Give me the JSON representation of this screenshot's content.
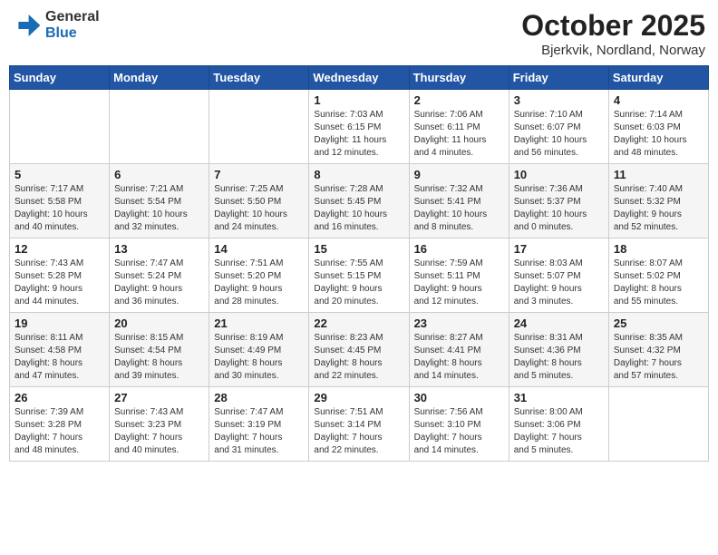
{
  "header": {
    "logo_line1": "General",
    "logo_line2": "Blue",
    "month": "October 2025",
    "location": "Bjerkvik, Nordland, Norway"
  },
  "weekdays": [
    "Sunday",
    "Monday",
    "Tuesday",
    "Wednesday",
    "Thursday",
    "Friday",
    "Saturday"
  ],
  "weeks": [
    [
      {
        "day": "",
        "info": ""
      },
      {
        "day": "",
        "info": ""
      },
      {
        "day": "",
        "info": ""
      },
      {
        "day": "1",
        "info": "Sunrise: 7:03 AM\nSunset: 6:15 PM\nDaylight: 11 hours\nand 12 minutes."
      },
      {
        "day": "2",
        "info": "Sunrise: 7:06 AM\nSunset: 6:11 PM\nDaylight: 11 hours\nand 4 minutes."
      },
      {
        "day": "3",
        "info": "Sunrise: 7:10 AM\nSunset: 6:07 PM\nDaylight: 10 hours\nand 56 minutes."
      },
      {
        "day": "4",
        "info": "Sunrise: 7:14 AM\nSunset: 6:03 PM\nDaylight: 10 hours\nand 48 minutes."
      }
    ],
    [
      {
        "day": "5",
        "info": "Sunrise: 7:17 AM\nSunset: 5:58 PM\nDaylight: 10 hours\nand 40 minutes."
      },
      {
        "day": "6",
        "info": "Sunrise: 7:21 AM\nSunset: 5:54 PM\nDaylight: 10 hours\nand 32 minutes."
      },
      {
        "day": "7",
        "info": "Sunrise: 7:25 AM\nSunset: 5:50 PM\nDaylight: 10 hours\nand 24 minutes."
      },
      {
        "day": "8",
        "info": "Sunrise: 7:28 AM\nSunset: 5:45 PM\nDaylight: 10 hours\nand 16 minutes."
      },
      {
        "day": "9",
        "info": "Sunrise: 7:32 AM\nSunset: 5:41 PM\nDaylight: 10 hours\nand 8 minutes."
      },
      {
        "day": "10",
        "info": "Sunrise: 7:36 AM\nSunset: 5:37 PM\nDaylight: 10 hours\nand 0 minutes."
      },
      {
        "day": "11",
        "info": "Sunrise: 7:40 AM\nSunset: 5:32 PM\nDaylight: 9 hours\nand 52 minutes."
      }
    ],
    [
      {
        "day": "12",
        "info": "Sunrise: 7:43 AM\nSunset: 5:28 PM\nDaylight: 9 hours\nand 44 minutes."
      },
      {
        "day": "13",
        "info": "Sunrise: 7:47 AM\nSunset: 5:24 PM\nDaylight: 9 hours\nand 36 minutes."
      },
      {
        "day": "14",
        "info": "Sunrise: 7:51 AM\nSunset: 5:20 PM\nDaylight: 9 hours\nand 28 minutes."
      },
      {
        "day": "15",
        "info": "Sunrise: 7:55 AM\nSunset: 5:15 PM\nDaylight: 9 hours\nand 20 minutes."
      },
      {
        "day": "16",
        "info": "Sunrise: 7:59 AM\nSunset: 5:11 PM\nDaylight: 9 hours\nand 12 minutes."
      },
      {
        "day": "17",
        "info": "Sunrise: 8:03 AM\nSunset: 5:07 PM\nDaylight: 9 hours\nand 3 minutes."
      },
      {
        "day": "18",
        "info": "Sunrise: 8:07 AM\nSunset: 5:02 PM\nDaylight: 8 hours\nand 55 minutes."
      }
    ],
    [
      {
        "day": "19",
        "info": "Sunrise: 8:11 AM\nSunset: 4:58 PM\nDaylight: 8 hours\nand 47 minutes."
      },
      {
        "day": "20",
        "info": "Sunrise: 8:15 AM\nSunset: 4:54 PM\nDaylight: 8 hours\nand 39 minutes."
      },
      {
        "day": "21",
        "info": "Sunrise: 8:19 AM\nSunset: 4:49 PM\nDaylight: 8 hours\nand 30 minutes."
      },
      {
        "day": "22",
        "info": "Sunrise: 8:23 AM\nSunset: 4:45 PM\nDaylight: 8 hours\nand 22 minutes."
      },
      {
        "day": "23",
        "info": "Sunrise: 8:27 AM\nSunset: 4:41 PM\nDaylight: 8 hours\nand 14 minutes."
      },
      {
        "day": "24",
        "info": "Sunrise: 8:31 AM\nSunset: 4:36 PM\nDaylight: 8 hours\nand 5 minutes."
      },
      {
        "day": "25",
        "info": "Sunrise: 8:35 AM\nSunset: 4:32 PM\nDaylight: 7 hours\nand 57 minutes."
      }
    ],
    [
      {
        "day": "26",
        "info": "Sunrise: 7:39 AM\nSunset: 3:28 PM\nDaylight: 7 hours\nand 48 minutes."
      },
      {
        "day": "27",
        "info": "Sunrise: 7:43 AM\nSunset: 3:23 PM\nDaylight: 7 hours\nand 40 minutes."
      },
      {
        "day": "28",
        "info": "Sunrise: 7:47 AM\nSunset: 3:19 PM\nDaylight: 7 hours\nand 31 minutes."
      },
      {
        "day": "29",
        "info": "Sunrise: 7:51 AM\nSunset: 3:14 PM\nDaylight: 7 hours\nand 22 minutes."
      },
      {
        "day": "30",
        "info": "Sunrise: 7:56 AM\nSunset: 3:10 PM\nDaylight: 7 hours\nand 14 minutes."
      },
      {
        "day": "31",
        "info": "Sunrise: 8:00 AM\nSunset: 3:06 PM\nDaylight: 7 hours\nand 5 minutes."
      },
      {
        "day": "",
        "info": ""
      }
    ]
  ]
}
